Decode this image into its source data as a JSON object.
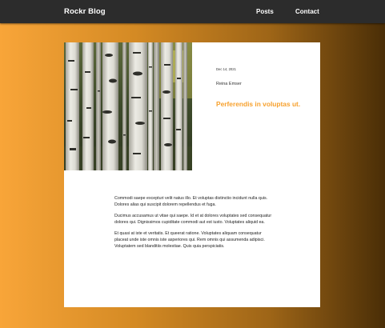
{
  "nav": {
    "brand": "Rockr Blog",
    "links": [
      {
        "label": "Posts"
      },
      {
        "label": "Contact"
      }
    ]
  },
  "post": {
    "date": "Dec 14, 2021",
    "author": "Reina Emser",
    "title": "Perferendis in voluptas ut.",
    "paragraphs": [
      "Commodi saepe excepturi velit natus illo. Et voluptas distinctio incidunt nulla quis. Dolores alias qui suscipit dolorem repellendus et fuga.",
      "Ducimus accusamus ut vitae qui saepe. Id et at dolores voluptates sed consequatur dolores qui. Dignissimos cupiditate commodi aut est iusto. Voluptates aliquid ea.",
      "Et quasi at iste et veritatis. Et queerat ratione. Voluptates aliquam consequatur placeat unde iste omnis iste asperiores qui. Rem omnis qui assumenda adipisci. Voluptatem sed blanditiis molestiae. Quis quia perspiciatis."
    ],
    "image_subject": "birch-forest"
  },
  "colors": {
    "navbar": "#2c2c2c",
    "accent": "#f7a12e",
    "gradient_start": "#f8a539",
    "gradient_end": "#4a2e07"
  }
}
